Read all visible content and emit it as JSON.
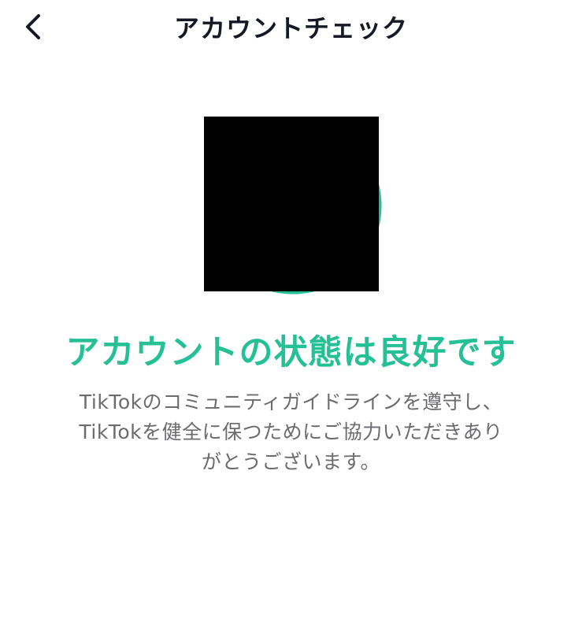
{
  "header": {
    "back_icon": "chevron-left-icon",
    "title": "アカウントチェック"
  },
  "main": {
    "graphic": {
      "description": "redacted illustration with green circular accent",
      "accent_color": "#26c097",
      "redaction_color": "#000000"
    },
    "status_title": "アカウントの状態は良好です",
    "description_lines": [
      "TikTokのコミュニティガイドラインを遵守し、",
      "TikTokを健全に保つためにご協力いただきあり",
      "がとうございます。"
    ]
  },
  "colors": {
    "accent": "#26c097",
    "title_text": "#161823",
    "body_text": "#6b6b70",
    "background": "#ffffff"
  }
}
